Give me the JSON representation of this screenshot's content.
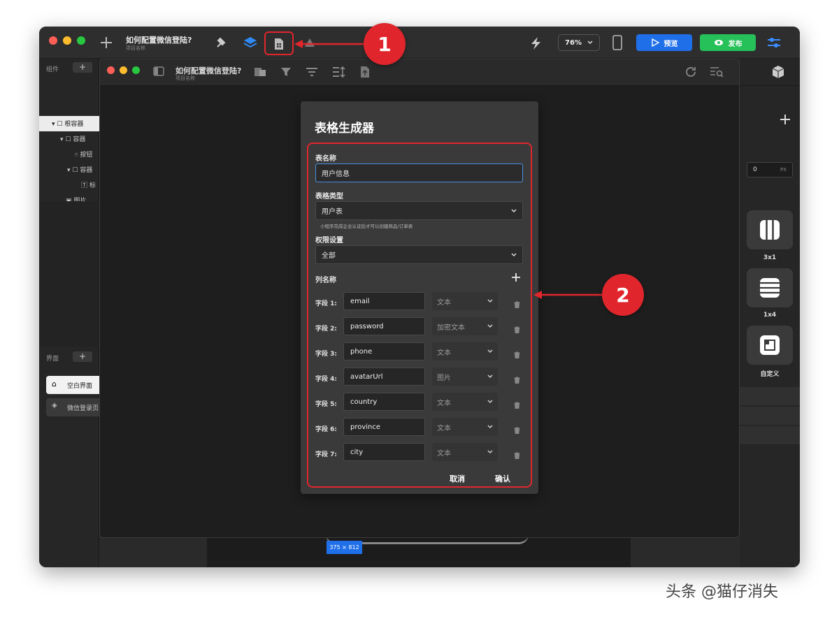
{
  "app": {
    "project_title": "如何配置微信登陆?",
    "project_subtitle": "项目名称",
    "zoom": "76%",
    "preview_label": "预览",
    "publish_label": "发布",
    "colors": {
      "preview": "#1f6fe8",
      "publish": "#27c15a",
      "callout": "#e0262c"
    }
  },
  "left_panel": {
    "components_header": "组件",
    "tree": [
      "根容器",
      "容器",
      "按钮",
      "容器",
      "标",
      "图片"
    ],
    "screens_header": "界面",
    "screens": [
      "空白界面",
      "微信登录页"
    ]
  },
  "inner_window": {
    "title": "如何配置微信登陆?",
    "subtitle": "项目名称"
  },
  "dialog": {
    "title": "表格生成器",
    "name_label": "表名称",
    "name_value": "用户信息",
    "type_label": "表格类型",
    "type_value": "用户表",
    "type_hint": "小程序完成企业认证后才可以创建商品/订单表",
    "perm_label": "权限设置",
    "perm_value": "全部",
    "columns_label": "列名称",
    "fields": [
      {
        "label": "字段 1:",
        "name": "email",
        "type": "文本"
      },
      {
        "label": "字段 2:",
        "name": "password",
        "type": "加密文本"
      },
      {
        "label": "字段 3:",
        "name": "phone",
        "type": "文本"
      },
      {
        "label": "字段 4:",
        "name": "avatarUrl",
        "type": "图片"
      },
      {
        "label": "字段 5:",
        "name": "country",
        "type": "文本"
      },
      {
        "label": "字段 6:",
        "name": "province",
        "type": "文本"
      },
      {
        "label": "字段 7:",
        "name": "city",
        "type": "文本"
      }
    ],
    "cancel_label": "取消",
    "confirm_label": "确认"
  },
  "right_panel": {
    "px_value": "0",
    "px_unit": "PX",
    "layouts": [
      "3x1",
      "1x4",
      "自定义"
    ]
  },
  "canvas": {
    "size_badge": "375 × 812"
  },
  "callouts": [
    "1",
    "2"
  ],
  "watermark": "头条 @猫仔消失"
}
